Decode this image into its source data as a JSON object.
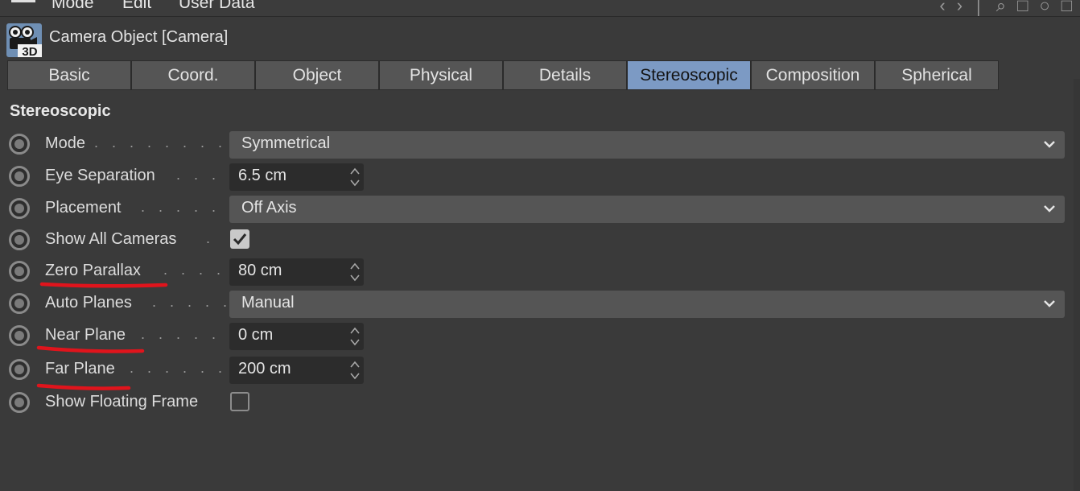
{
  "menubar": {
    "items": [
      "Mode",
      "Edit",
      "User Data"
    ]
  },
  "header": {
    "icon": "camera-3d-icon",
    "icon_badge": "3D",
    "title": "Camera Object [Camera]"
  },
  "tabs": [
    {
      "label": "Basic",
      "active": false
    },
    {
      "label": "Coord.",
      "active": false
    },
    {
      "label": "Object",
      "active": false
    },
    {
      "label": "Physical",
      "active": false
    },
    {
      "label": "Details",
      "active": false
    },
    {
      "label": "Stereoscopic",
      "active": true
    },
    {
      "label": "Composition",
      "active": false
    },
    {
      "label": "Spherical",
      "active": false
    }
  ],
  "section": {
    "title": "Stereoscopic"
  },
  "fields": {
    "mode": {
      "label": "Mode",
      "value": "Symmetrical"
    },
    "eye_separation": {
      "label": "Eye Separation",
      "value": "6.5 cm"
    },
    "placement": {
      "label": "Placement",
      "value": "Off Axis"
    },
    "show_all_cameras": {
      "label": "Show All Cameras",
      "checked": true
    },
    "zero_parallax": {
      "label": "Zero Parallax",
      "value": "80 cm"
    },
    "auto_planes": {
      "label": "Auto Planes",
      "value": "Manual"
    },
    "near_plane": {
      "label": "Near Plane",
      "value": "0 cm"
    },
    "far_plane": {
      "label": "Far Plane",
      "value": "200 cm"
    },
    "show_floating_frame": {
      "label": "Show Floating Frame",
      "checked": false
    }
  },
  "colors": {
    "panel_bg": "#3a3a3a",
    "tab_bg": "#555555",
    "tab_active_bg": "#7c9ac4",
    "annotation": "#e0141c"
  }
}
